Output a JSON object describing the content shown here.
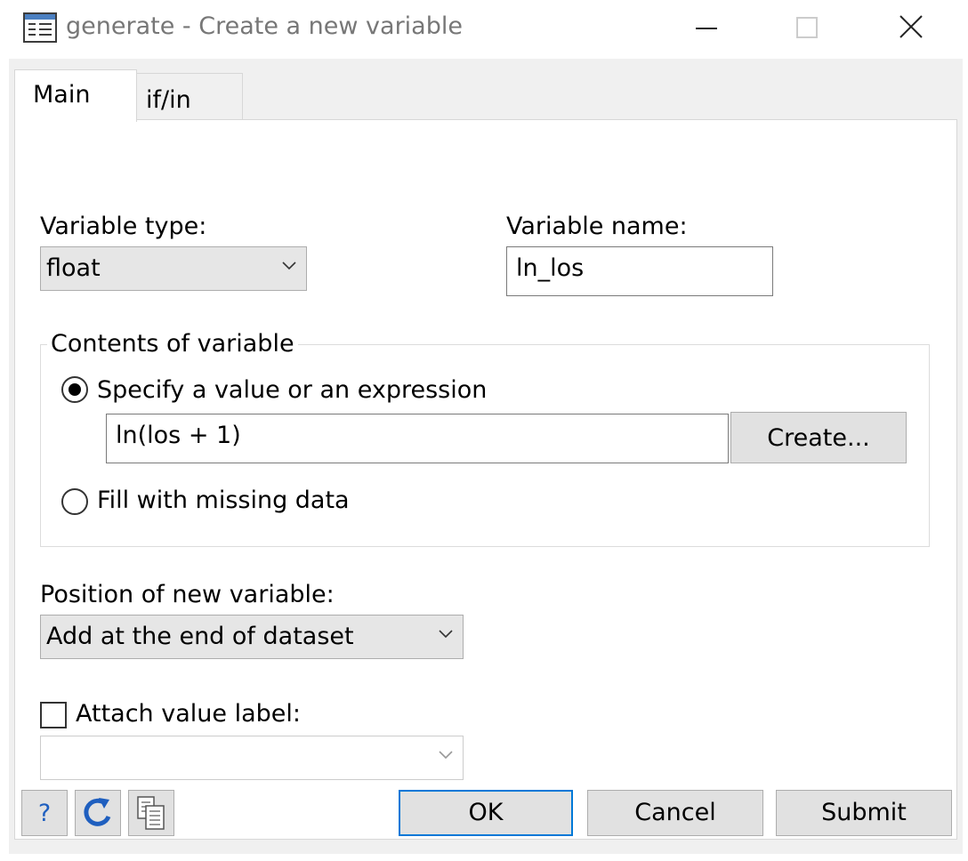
{
  "window": {
    "title": "generate - Create a new variable"
  },
  "tabs": [
    {
      "label": "Main",
      "active": true
    },
    {
      "label": "if/in",
      "active": false
    }
  ],
  "variable_type": {
    "label": "Variable type:",
    "value": "float"
  },
  "variable_name": {
    "label": "Variable name:",
    "value": "ln_los"
  },
  "contents": {
    "group_label": "Contents of variable",
    "option_expression": "Specify a value or an expression",
    "expression_value": "ln(los + 1)",
    "create_button": "Create...",
    "option_missing": "Fill with missing data",
    "selected": "expression"
  },
  "position": {
    "label": "Position of new variable:",
    "value": "Add at the end of dataset"
  },
  "value_label": {
    "label": "Attach value label:",
    "checked": false,
    "value": ""
  },
  "footer": {
    "help_label": "?",
    "reset_icon": "refresh-icon",
    "copy_icon": "copy-command-icon",
    "ok_label": "OK",
    "cancel_label": "Cancel",
    "submit_label": "Submit"
  },
  "colors": {
    "accent": "#0078d7",
    "help_blue": "#1f5fbf"
  }
}
